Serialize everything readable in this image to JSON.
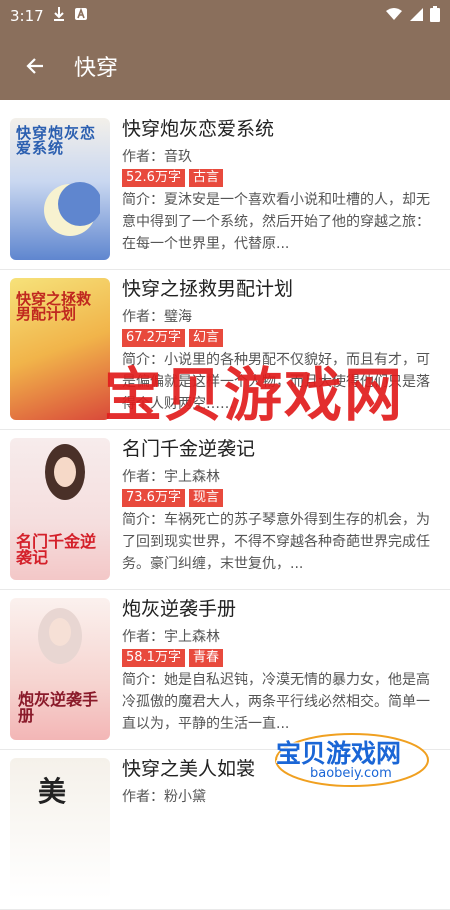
{
  "status": {
    "time": "3:17"
  },
  "header": {
    "title": "快穿"
  },
  "books": [
    {
      "title": "快穿炮灰恋爱系统",
      "author_label": "作者：音玖",
      "words": "52.6万字",
      "genre": "古言",
      "intro": "简介：夏沐安是一个喜欢看小说和吐槽的人，却无意中得到了一个系统，然后开始了他的穿越之旅：在每一个世界里，代替原..."
    },
    {
      "title": "快穿之拯救男配计划",
      "author_label": "作者：璧海",
      "words": "67.2万字",
      "genre": "幻言",
      "intro": "简介：小说里的各种男配不仅貌好，而且有才，可是偏偏就是这样一个人物，而且大使得他们只是落得个人财两空……"
    },
    {
      "title": "名门千金逆袭记",
      "author_label": "作者：宇上森林",
      "words": "73.6万字",
      "genre": "现言",
      "intro": "简介：车祸死亡的苏子琴意外得到生存的机会，为了回到现实世界，不得不穿越各种奇葩世界完成任务。豪门纠缠，末世复仇，..."
    },
    {
      "title": "炮灰逆袭手册",
      "author_label": "作者：宇上森林",
      "words": "58.1万字",
      "genre": "青春",
      "intro": "简介：她是自私迟钝，冷漠无情的暴力女，他是高冷孤傲的魔君大人，两条平行线必然相交。简单一直以为，平静的生活一直..."
    },
    {
      "title": "快穿之美人如裳",
      "author_label": "作者：粉小黛",
      "words": "",
      "genre": "",
      "intro": ""
    }
  ],
  "covers": [
    {
      "text": "快穿炮灰恋爱系统",
      "colors": [
        "#f3f0ea",
        "#5f86cf"
      ]
    },
    {
      "text": "快穿之拯救男配计划",
      "colors": [
        "#f6e27a",
        "#d9493a"
      ]
    },
    {
      "text": "名门千金逆袭记",
      "colors": [
        "#f7ecec",
        "#f3c7c7"
      ]
    },
    {
      "text": "炮灰逆袭手册",
      "colors": [
        "#fbf1ee",
        "#f3b6b6"
      ]
    },
    {
      "text": "美",
      "colors": [
        "#f5f1ea",
        "#ffffff"
      ]
    }
  ],
  "watermark": {
    "center_text": "宝贝游戏网",
    "logo_text": "宝贝游戏网",
    "logo_domain": "baobeiy.com"
  },
  "colors": {
    "app_bar": "#8a6f5c",
    "tag": "#e84a3d"
  }
}
